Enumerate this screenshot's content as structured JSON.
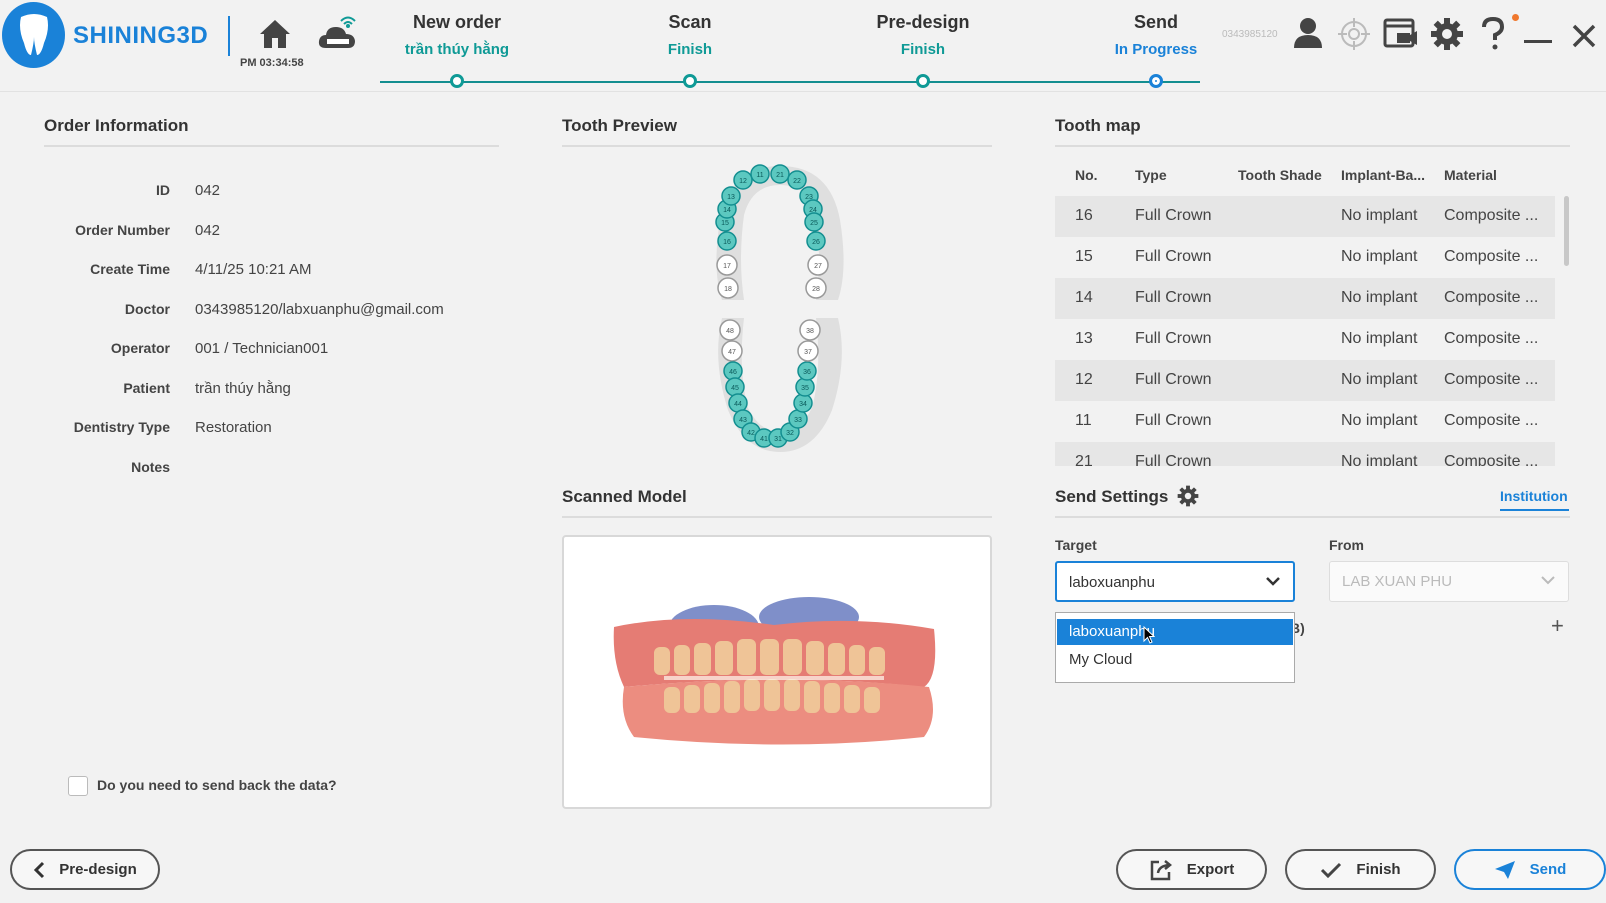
{
  "brand": {
    "name": "SHINING3D"
  },
  "clock": "PM 03:34:58",
  "steps": [
    {
      "title": "New order",
      "status": "trần thúy hằng"
    },
    {
      "title": "Scan",
      "status": "Finish"
    },
    {
      "title": "Pre-design",
      "status": "Finish"
    },
    {
      "title": "Send",
      "status": "In Progress"
    }
  ],
  "user_id": "0343985120",
  "order_info": {
    "title": "Order Information",
    "rows": [
      {
        "label": "ID",
        "value": "042"
      },
      {
        "label": "Order Number",
        "value": "042"
      },
      {
        "label": "Create Time",
        "value": "4/11/25 10:21 AM"
      },
      {
        "label": "Doctor",
        "value": "0343985120/labxuanphu@gmail.com"
      },
      {
        "label": "Operator",
        "value": "001 / Technician001"
      },
      {
        "label": "Patient",
        "value": "trần thúy hằng"
      },
      {
        "label": "Dentistry Type",
        "value": "Restoration"
      },
      {
        "label": "Notes",
        "value": ""
      }
    ],
    "send_back_label": "Do you need to send back the data?"
  },
  "tooth_preview": {
    "title": "Tooth Preview",
    "upper": [
      "18",
      "17",
      "16",
      "15",
      "14",
      "13",
      "12",
      "11",
      "21",
      "22",
      "23",
      "24",
      "25",
      "26",
      "27",
      "28"
    ],
    "lower": [
      "48",
      "47",
      "46",
      "45",
      "44",
      "43",
      "42",
      "41",
      "31",
      "32",
      "33",
      "34",
      "35",
      "36",
      "37",
      "38"
    ],
    "selected": [
      "16",
      "15",
      "14",
      "13",
      "12",
      "11",
      "21",
      "22",
      "23",
      "24",
      "25",
      "26",
      "46",
      "45",
      "44",
      "43",
      "42",
      "41",
      "31",
      "32",
      "33",
      "34",
      "35",
      "36"
    ]
  },
  "scanned_model": {
    "title": "Scanned Model"
  },
  "tooth_map": {
    "title": "Tooth map",
    "columns": [
      "No.",
      "Type",
      "Tooth Shade",
      "Implant-Ba...",
      "Material"
    ],
    "rows": [
      {
        "no": "16",
        "type": "Full Crown",
        "shade": "",
        "implant": "No implant",
        "material": "Composite ..."
      },
      {
        "no": "15",
        "type": "Full Crown",
        "shade": "",
        "implant": "No implant",
        "material": "Composite ..."
      },
      {
        "no": "14",
        "type": "Full Crown",
        "shade": "",
        "implant": "No implant",
        "material": "Composite ..."
      },
      {
        "no": "13",
        "type": "Full Crown",
        "shade": "",
        "implant": "No implant",
        "material": "Composite ..."
      },
      {
        "no": "12",
        "type": "Full Crown",
        "shade": "",
        "implant": "No implant",
        "material": "Composite ..."
      },
      {
        "no": "11",
        "type": "Full Crown",
        "shade": "",
        "implant": "No implant",
        "material": "Composite ..."
      },
      {
        "no": "21",
        "type": "Full Crown",
        "shade": "",
        "implant": "No implant",
        "material": "Composite ..."
      }
    ]
  },
  "send_settings": {
    "title": "Send Settings",
    "tab": "Institution",
    "target_label": "Target",
    "target_value": "laboxuanphu",
    "from_label": "From",
    "from_value": "LAB XUAN PHU",
    "dropdown_options": [
      "laboxuanphu",
      "My Cloud"
    ],
    "partial_text": "B)"
  },
  "buttons": {
    "back": "Pre-design",
    "export": "Export",
    "finish": "Finish",
    "send": "Send"
  },
  "colors": {
    "accent": "#1a82d8",
    "teal": "#0f9a96"
  }
}
